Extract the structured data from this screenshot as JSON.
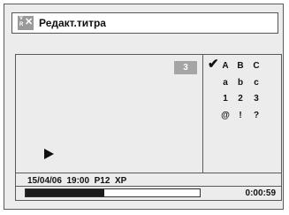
{
  "title": {
    "icon": "title-edit-icon",
    "text": "Редакт.титра"
  },
  "preview": {
    "title_number": "3",
    "play_icon": "play-icon"
  },
  "char_panel": {
    "check_icon": "checkmark-icon",
    "rows": [
      [
        "A",
        "B",
        "C"
      ],
      [
        "a",
        "b",
        "c"
      ],
      [
        "1",
        "2",
        "3"
      ],
      [
        "@",
        "!",
        "?"
      ]
    ]
  },
  "info": {
    "text": "15/04/06  19:00  P12  XP"
  },
  "playback": {
    "progress": 0.45,
    "time": "0:00:59"
  },
  "colors": {
    "background": "#ececec",
    "progress_fill": "#1c1c1c",
    "badge": "#a5a5a5"
  }
}
